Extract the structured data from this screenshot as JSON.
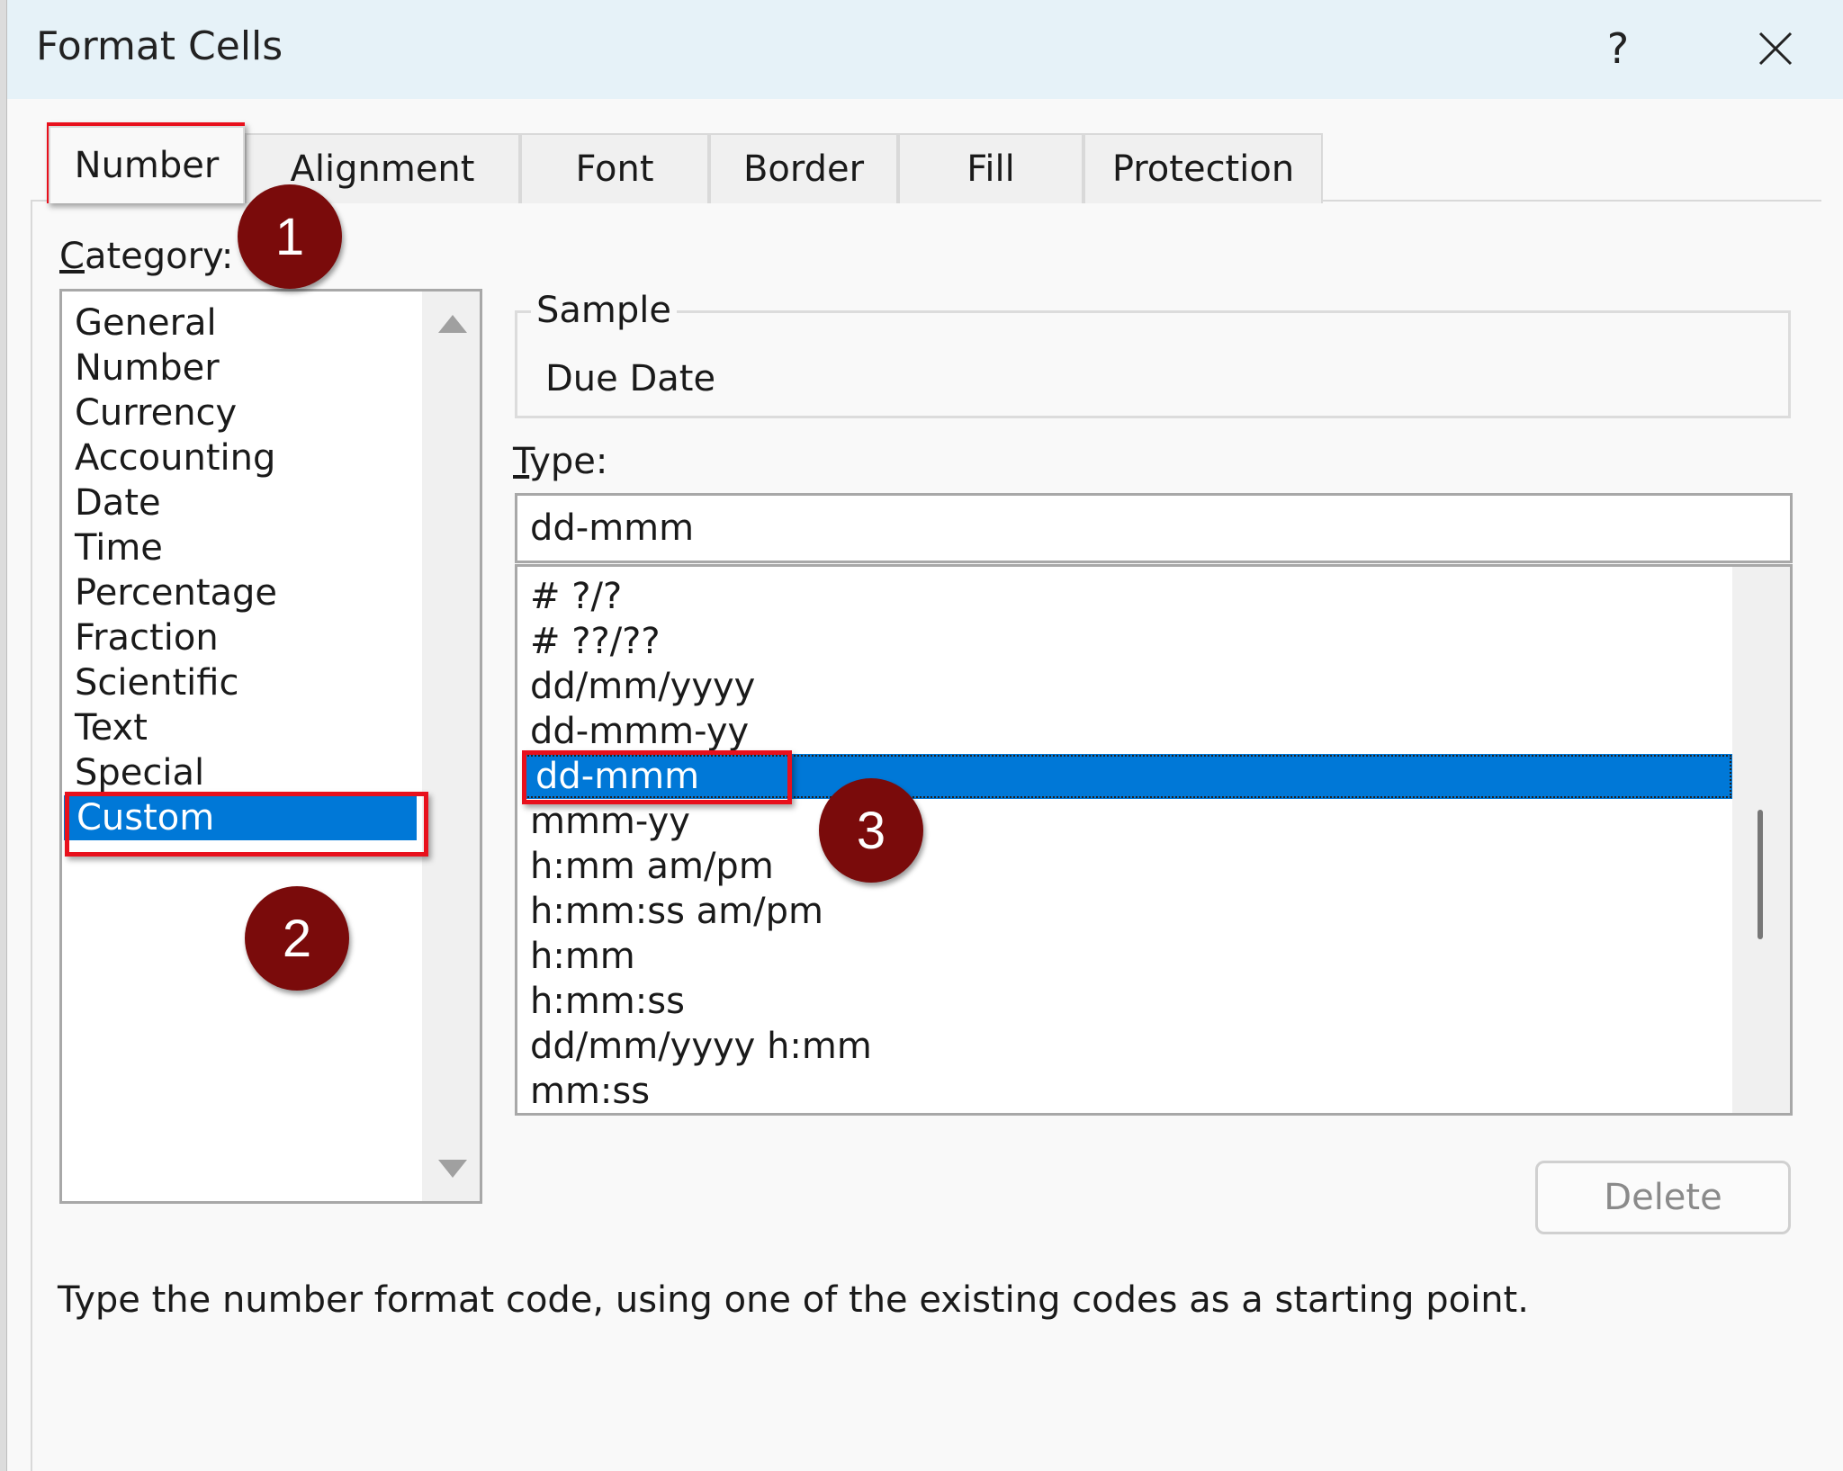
{
  "dialog": {
    "title": "Format Cells",
    "help_label": "?"
  },
  "tabs": [
    {
      "label": "Number",
      "active": true
    },
    {
      "label": "Alignment"
    },
    {
      "label": "Font"
    },
    {
      "label": "Border"
    },
    {
      "label": "Fill"
    },
    {
      "label": "Protection"
    }
  ],
  "category": {
    "label_underlined": "C",
    "label_rest": "ategory:",
    "items": [
      "General",
      "Number",
      "Currency",
      "Accounting",
      "Date",
      "Time",
      "Percentage",
      "Fraction",
      "Scientific",
      "Text",
      "Special",
      "Custom"
    ],
    "selected": "Custom"
  },
  "sample": {
    "legend": "Sample",
    "value": "Due Date"
  },
  "type": {
    "label_underlined": "T",
    "label_rest": "ype:",
    "input_value": "dd-mmm",
    "list": [
      "# ?/?",
      "# ??/??",
      "dd/mm/yyyy",
      "dd-mmm-yy",
      "dd-mmm",
      "mmm-yy",
      "h:mm am/pm",
      "h:mm:ss am/pm",
      "h:mm",
      "h:mm:ss",
      "dd/mm/yyyy h:mm",
      "mm:ss"
    ],
    "selected": "dd-mmm"
  },
  "buttons": {
    "delete": "Delete"
  },
  "hint": "Type the number format code, using one of the existing codes as a starting point.",
  "annotations": {
    "step1": "1",
    "step2": "2",
    "step3": "3",
    "highlight_color": "#e8101c",
    "badge_color": "#7a0b0b"
  },
  "colors": {
    "selection": "#0078d7",
    "titlebar": "#e6f2f8"
  }
}
